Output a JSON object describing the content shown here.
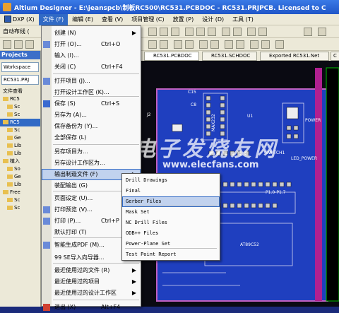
{
  "window": {
    "title": "Altium Designer - E:\\jeanspcb\\制板RC500\\RC531.PCBDOC - RC531.PRJPCB. Licensed to C"
  },
  "menubar": {
    "items": [
      {
        "label": "DXP (X)"
      },
      {
        "label": "文件 (F)"
      },
      {
        "label": "编辑 (E)"
      },
      {
        "label": "查看 (V)"
      },
      {
        "label": "项目管理 (C)"
      },
      {
        "label": "放置 (P)"
      },
      {
        "label": "设计 (D)"
      },
      {
        "label": "工具 (T)"
      }
    ]
  },
  "toolbar": {
    "autoroute_label": "自动布线 ("
  },
  "projects_panel": {
    "title": "Projects",
    "workspace": "Workspace",
    "project": "RC531.PRJ",
    "file_view": "文件查看",
    "tree": [
      "RC5",
      "Sc",
      "Sc",
      "RC5",
      "Sc",
      "Ge",
      "Lib",
      "Lib",
      "植入",
      "So",
      "Ge",
      "Lib",
      "Free",
      "Sc",
      "Sc"
    ]
  },
  "doc_tabs": [
    "RC531.PCBDOC",
    "RC531.SCHDOC",
    "Exported RC531.Net",
    "C"
  ],
  "file_menu": {
    "items": [
      {
        "label": "创建 (N)",
        "shortcut": "",
        "arrow": "▶"
      },
      {
        "label": "打开 (O)...",
        "shortcut": "Ctrl+O",
        "arrow": ""
      },
      {
        "label": "输入 (I)...",
        "shortcut": "",
        "arrow": ""
      },
      {
        "label": "关闭 (C)",
        "shortcut": "Ctrl+F4",
        "arrow": ""
      },
      {
        "label": "打开项目 (J)...",
        "shortcut": "",
        "arrow": ""
      },
      {
        "label": "打开设计工作区 (K)...",
        "shortcut": "",
        "arrow": ""
      },
      {
        "label": "保存 (S)",
        "shortcut": "Ctrl+S",
        "arrow": ""
      },
      {
        "label": "另存为 (A)...",
        "shortcut": "",
        "arrow": ""
      },
      {
        "label": "保存备份为 (Y)...",
        "shortcut": "",
        "arrow": ""
      },
      {
        "label": "全部保存 (L)",
        "shortcut": "",
        "arrow": ""
      },
      {
        "label": "另存项目为...",
        "shortcut": "",
        "arrow": ""
      },
      {
        "label": "另存设计工作区为...",
        "shortcut": "",
        "arrow": ""
      },
      {
        "label": "输出制造文件 (F)",
        "shortcut": "",
        "arrow": "▶"
      },
      {
        "label": "装配输出 (G)",
        "shortcut": "",
        "arrow": "▶"
      },
      {
        "label": "页面设定 (U)...",
        "shortcut": "",
        "arrow": ""
      },
      {
        "label": "打印预览 (V)...",
        "shortcut": "",
        "arrow": ""
      },
      {
        "label": "打印 (P)...",
        "shortcut": "Ctrl+P",
        "arrow": ""
      },
      {
        "label": "默认打印 (T)",
        "shortcut": "",
        "arrow": ""
      },
      {
        "label": "智能生成PDF (M)...",
        "shortcut": "",
        "arrow": ""
      },
      {
        "label": "99 SE导入向导器...",
        "shortcut": "",
        "arrow": ""
      },
      {
        "label": "最近使用过的文件 (R)",
        "shortcut": "",
        "arrow": "▶"
      },
      {
        "label": "最近使用过的项目",
        "shortcut": "",
        "arrow": "▶"
      },
      {
        "label": "最近使用过的设计工作区",
        "shortcut": "",
        "arrow": "▶"
      },
      {
        "label": "退出 (X)",
        "shortcut": "Alt+F4",
        "arrow": ""
      }
    ]
  },
  "submenu": {
    "items": [
      "Drill Drawings",
      "Final",
      "Gerber Files",
      "Mask Set",
      "NC Drill Files",
      "ODB++ Files",
      "Power-Plane Set",
      "Test Point Report"
    ]
  },
  "pcb": {
    "labels": [
      "C15",
      "C8",
      "U1",
      "POWER",
      "SWITCH1",
      "LED_POWER",
      "P1.0-P1.7",
      "MAX232",
      "AT89C52",
      "J2"
    ]
  },
  "watermark": {
    "line1": "电子发烧友网",
    "line2": "www.elecfans.com"
  },
  "colors": {
    "menu_highlight": "#c1d2ee",
    "pcb_blue": "#1f3fbf",
    "title_blue": "#2a62d6"
  }
}
